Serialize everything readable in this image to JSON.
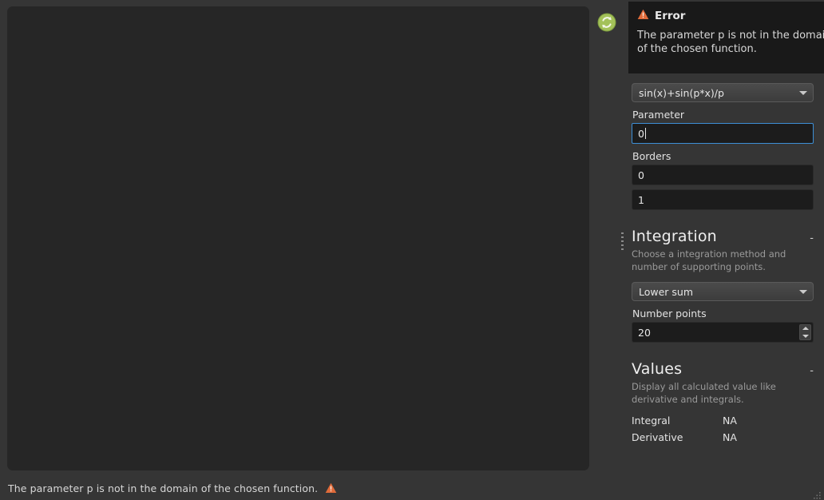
{
  "app": {
    "background_color": "#353535",
    "panel_color": "#353535",
    "plot_color": "#262626",
    "accent_focus_color": "#3d8fd6",
    "warning_color": "#e06b3a"
  },
  "plot": {
    "name": "function-plot-canvas",
    "content": ""
  },
  "toolbar": {
    "refresh_icon": "refresh-icon"
  },
  "error": {
    "icon": "warning-triangle-icon",
    "title": "Error",
    "message": "The parameter p is not in the domain of the chosen function."
  },
  "controls": {
    "function_select": {
      "label": "",
      "value": "sin(x)+sin(p*x)/p",
      "icon": "chevron-down-icon"
    },
    "parameter": {
      "label": "Parameter",
      "value": "0",
      "focused": true
    },
    "borders": {
      "label": "Borders",
      "lower_value": "0",
      "upper_value": "1"
    }
  },
  "integration": {
    "title": "Integration",
    "collapse_label": "-",
    "description": "Choose a integration method and number of supporting points.",
    "method_select": {
      "value": "Lower sum",
      "icon": "chevron-down-icon"
    },
    "number_points": {
      "label": "Number points",
      "value": "20"
    }
  },
  "values": {
    "title": "Values",
    "collapse_label": "-",
    "description": "Display all calculated value like derivative and integrals.",
    "rows": [
      {
        "key": "Integral",
        "value": "NA"
      },
      {
        "key": "Derivative",
        "value": "NA"
      }
    ]
  },
  "status_bar": {
    "message": "The parameter p is not in the domain of the chosen function.",
    "icon": "warning-triangle-icon"
  }
}
